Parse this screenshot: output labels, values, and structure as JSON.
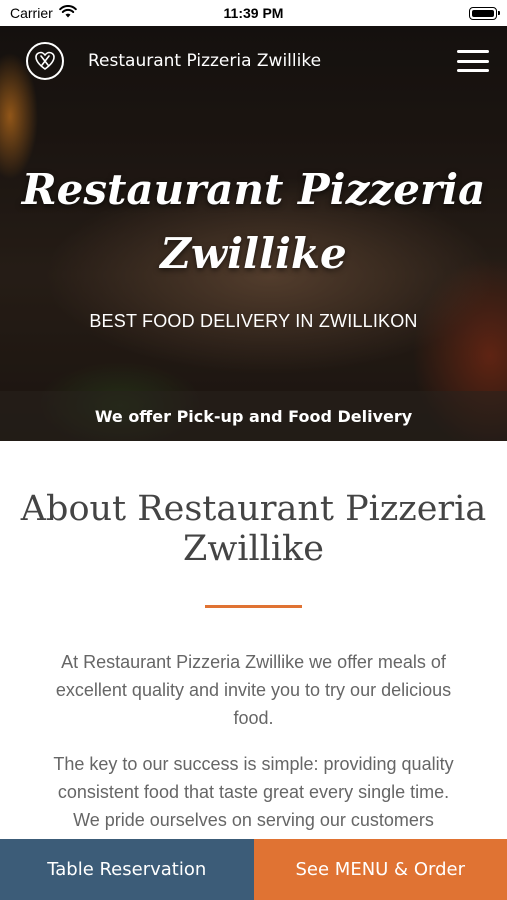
{
  "status_bar": {
    "carrier": "Carrier",
    "time": "11:39 PM"
  },
  "nav": {
    "brand": "Restaurant Pizzeria Zwillike"
  },
  "hero": {
    "title_line1": "Restaurant Pizzeria",
    "title_line2": "Zwillike",
    "subtitle": "BEST FOOD DELIVERY IN ZWILLIKON",
    "band_text": "We offer Pick-up and Food Delivery"
  },
  "about": {
    "title_line1": "About Restaurant Pizzeria",
    "title_line2": "Zwillike",
    "paragraph1_line1": "At Restaurant Pizzeria Zwillike we offer meals of",
    "paragraph1_line2": "excellent quality and invite you to try our delicious",
    "paragraph1_line3": "food.",
    "paragraph2_line1": "The key to our success is simple: providing quality",
    "paragraph2_line2": "consistent food that taste great every single time.",
    "paragraph2_line3": "We pride ourselves on serving our customers"
  },
  "actions": {
    "reservation_label": "Table Reservation",
    "order_label": "See MENU & Order"
  },
  "colors": {
    "accent": "#e07333",
    "reservation_bg": "#3c5c78"
  },
  "icons": {
    "logo": "fork-knife-heart-icon",
    "menu": "hamburger-icon",
    "wifi": "wifi-icon",
    "battery": "battery-icon"
  }
}
